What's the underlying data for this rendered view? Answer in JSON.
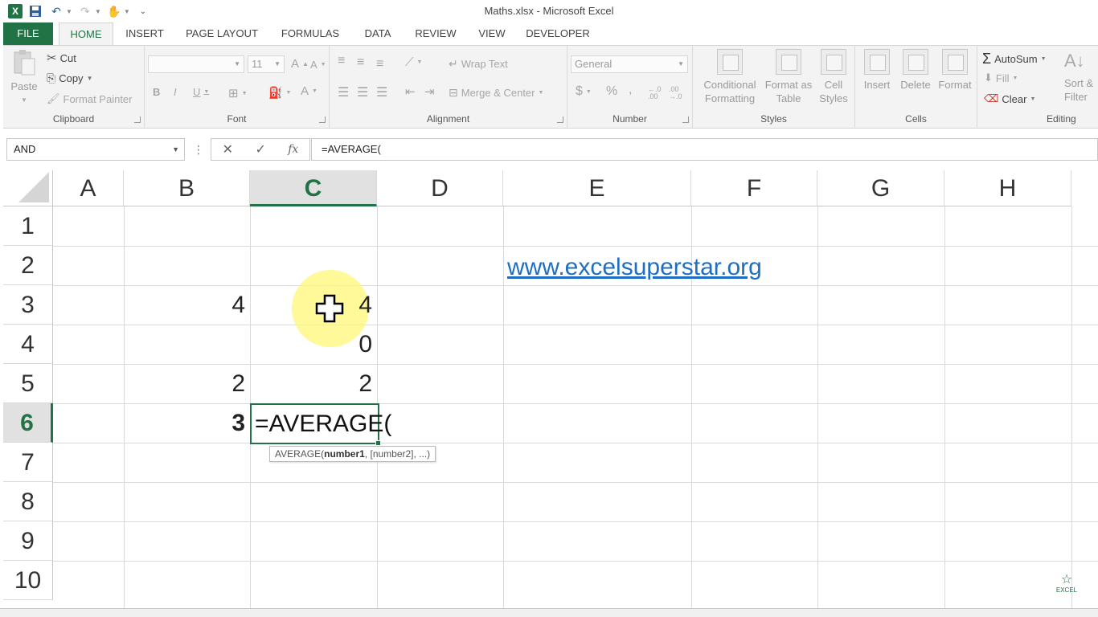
{
  "window": {
    "title": "Maths.xlsx - Microsoft Excel"
  },
  "ribbon_tabs": [
    "FILE",
    "HOME",
    "INSERT",
    "PAGE LAYOUT",
    "FORMULAS",
    "DATA",
    "REVIEW",
    "VIEW",
    "DEVELOPER"
  ],
  "clipboard": {
    "paste": "Paste",
    "cut": "Cut",
    "copy": "Copy",
    "format_painter": "Format Painter",
    "label": "Clipboard"
  },
  "font": {
    "size": "11",
    "grow": "A",
    "shrink": "A",
    "bold": "B",
    "italic": "I",
    "underline": "U",
    "color": "A",
    "label": "Font"
  },
  "alignment": {
    "wrap_text": "Wrap Text",
    "merge_center": "Merge & Center",
    "label": "Alignment"
  },
  "number": {
    "format": "General",
    "currency": "$",
    "percent": "%",
    "comma": ",",
    "inc_decimal": "←.0 .00",
    "dec_decimal": ".00 →.0",
    "label": "Number"
  },
  "styles": {
    "conditional": "Conditional Formatting",
    "format_table": "Format as Table",
    "cell_styles": "Cell Styles",
    "label": "Styles"
  },
  "cells": {
    "insert": "Insert",
    "delete": "Delete",
    "format": "Format",
    "label": "Cells"
  },
  "editing": {
    "autosum": "AutoSum",
    "fill": "Fill",
    "clear": "Clear",
    "sort_filter": "Sort & Filter",
    "label": "Editing"
  },
  "formula_bar": {
    "name_box": "AND",
    "formula": "=AVERAGE("
  },
  "sheet": {
    "columns": [
      "A",
      "B",
      "C",
      "D",
      "E",
      "F",
      "G",
      "H"
    ],
    "selected_column": "C",
    "rows": [
      "1",
      "2",
      "3",
      "4",
      "5",
      "6",
      "7",
      "8",
      "9",
      "10"
    ],
    "selected_row": "6",
    "cells": {
      "B3": "4",
      "C3": "4",
      "C4": "0",
      "B5": "2",
      "C5": "2",
      "B6": "3",
      "C6": "=AVERAGE(",
      "E2": "www.excelsuperstar.org"
    },
    "tooltip": {
      "fn": "AVERAGE(",
      "arg1": "number1",
      "rest": ", [number2], ...)"
    }
  },
  "watermark": {
    "text": "EXCEL"
  },
  "colors": {
    "accent": "#217346",
    "link": "#1e6fc4"
  }
}
